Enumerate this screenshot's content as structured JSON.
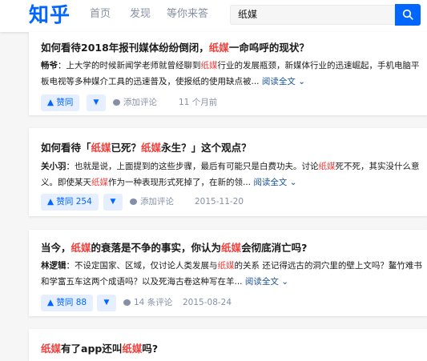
{
  "header": {
    "logo": "知乎",
    "nav": [
      "首页",
      "发现",
      "等你来答"
    ],
    "search_value": "纸媒"
  },
  "results": [
    {
      "title_parts": [
        "如何看待2018年报刊媒体纷纷倒闭，",
        "纸媒",
        "一命呜呼的现状？"
      ],
      "author": "畅爷",
      "excerpt_parts": [
        "：上大学的时候新闻学老师就曾经聊到",
        "纸媒",
        "行业的发展瓶颈，新媒体行业的迅速崛起，手机电脑平板电视等多种媒介工具的迅速普及，使报纸的使用缺点被..."
      ],
      "read_more": "阅读全文 ⌄",
      "vote": "▲ 赞同",
      "vote_down": "▼",
      "comment": "添加评论",
      "date": "11 个月前"
    },
    {
      "title_parts": [
        "如何看待「",
        "纸媒",
        "已死？",
        "纸媒",
        "永生？」这个观点？"
      ],
      "author": "关小羽",
      "excerpt_parts": [
        "：也就是说，上面提到的这些步骤，最后有可能只是白费功夫。讨论",
        "纸媒",
        "死不死，其实没什么意义。即使某天",
        "纸媒",
        "作为一种表现形式死掉了，在新的领..."
      ],
      "read_more": "阅读全文 ⌄",
      "vote": "▲ 赞同 254",
      "vote_down": "▼",
      "comment": "添加评论",
      "date": "2015-11-20"
    },
    {
      "title_parts": [
        "当今，",
        "纸媒",
        "的衰落是不争的事实，你认为",
        "纸媒",
        "会彻底消亡吗?"
      ],
      "author": "林逻辑",
      "excerpt_parts": [
        "：不设定国家、区域，仅讨论人类发展与",
        "纸媒",
        "的关系 还记得远古的洞穴里的壁上文吗？鳌竹难书和学富五车这两个成语吗？以及死海古卷这种写在羊..."
      ],
      "read_more": "阅读全文 ⌄",
      "vote": "▲ 赞同 88",
      "vote_down": "▼",
      "comment": "14 条评论",
      "date": "2015-08-24"
    },
    {
      "title_parts": [
        "纸媒",
        "有了app还叫",
        "纸媒",
        "吗?"
      ]
    }
  ],
  "colors": {
    "brand": "#0066ff",
    "highlight": "#f1403c",
    "link": "#175199",
    "muted": "#8590a6"
  }
}
